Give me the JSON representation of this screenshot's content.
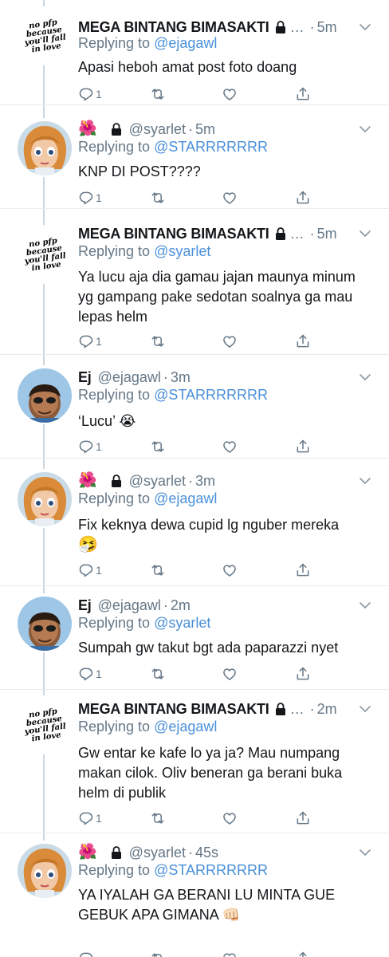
{
  "colors": {
    "link": "#4a90d9",
    "muted": "#657786",
    "text": "#14171a",
    "divider": "#e6ecf0"
  },
  "tweets": [
    {
      "avatar": "no-pfp-text-avatar",
      "avatar_text": "no pfp\nbecause\nyou'll fall\nin love",
      "name": "MEGA BINTANG BIMASAKTI",
      "flower": "",
      "handle": "",
      "ellipsis": "…",
      "time": "5m",
      "reply_prefix": "Replying to",
      "reply_to": "@ejagawl",
      "text": "Apasi heboh amat post foto doang",
      "emoji": "",
      "reply_count": "1"
    },
    {
      "avatar": "cartoon-girl-avatar",
      "avatar_text": "",
      "name": "",
      "flower": "🌺",
      "handle": "@syarlet",
      "ellipsis": "",
      "time": "5m",
      "reply_prefix": "Replying to",
      "reply_to": "@STARRRRRRR",
      "text": "KNP DI POST????",
      "emoji": "",
      "reply_count": "1"
    },
    {
      "avatar": "no-pfp-text-avatar",
      "avatar_text": "no pfp\nbecause\nyou'll fall\nin love",
      "name": "MEGA BINTANG BIMASAKTI",
      "flower": "",
      "handle": "",
      "ellipsis": "…",
      "time": "5m",
      "reply_prefix": "Replying to",
      "reply_to": "@syarlet",
      "text": "Ya lucu aja dia gamau jajan maunya minum yg gampang pake sedotan soalnya ga mau lepas helm",
      "emoji": "",
      "reply_count": "1"
    },
    {
      "avatar": "cartoon-face-avatar",
      "avatar_text": "",
      "name": "Ej",
      "flower": "",
      "handle": "@ejagawl",
      "ellipsis": "",
      "time": "3m",
      "reply_prefix": "Replying to",
      "reply_to": "@STARRRRRRR",
      "text": "‘Lucu’ 😭",
      "emoji": "",
      "reply_count": "1"
    },
    {
      "avatar": "cartoon-girl-avatar",
      "avatar_text": "",
      "name": "",
      "flower": "🌺",
      "handle": "@syarlet",
      "ellipsis": "",
      "time": "3m",
      "reply_prefix": "Replying to",
      "reply_to": "@ejagawl",
      "text": "Fix keknya dewa cupid lg nguber mereka",
      "emoji": "🤧",
      "reply_count": "1"
    },
    {
      "avatar": "cartoon-face-avatar",
      "avatar_text": "",
      "name": "Ej",
      "flower": "",
      "handle": "@ejagawl",
      "ellipsis": "",
      "time": "2m",
      "reply_prefix": "Replying to",
      "reply_to": "@syarlet",
      "text": "Sumpah gw takut bgt ada paparazzi nyet",
      "emoji": "",
      "reply_count": "1"
    },
    {
      "avatar": "no-pfp-text-avatar",
      "avatar_text": "no pfp\nbecause\nyou'll fall\nin love",
      "name": "MEGA BINTANG BIMASAKTI",
      "flower": "",
      "handle": "",
      "ellipsis": "…",
      "time": "2m",
      "reply_prefix": "Replying to",
      "reply_to": "@ejagawl",
      "text": "Gw entar ke kafe lo ya ja? Mau numpang makan cilok. Oliv beneran ga berani buka helm di publik",
      "emoji": "",
      "reply_count": "1"
    },
    {
      "avatar": "cartoon-girl-avatar",
      "avatar_text": "",
      "name": "",
      "flower": "🌺",
      "handle": "@syarlet",
      "ellipsis": "",
      "time": "45s",
      "reply_prefix": "Replying to",
      "reply_to": "@STARRRRRRR",
      "text": "YA IYALAH  GA BERANI LU MINTA GUE GEBUK APA GIMANA 👊🏻",
      "emoji": "",
      "reply_count": ""
    }
  ]
}
